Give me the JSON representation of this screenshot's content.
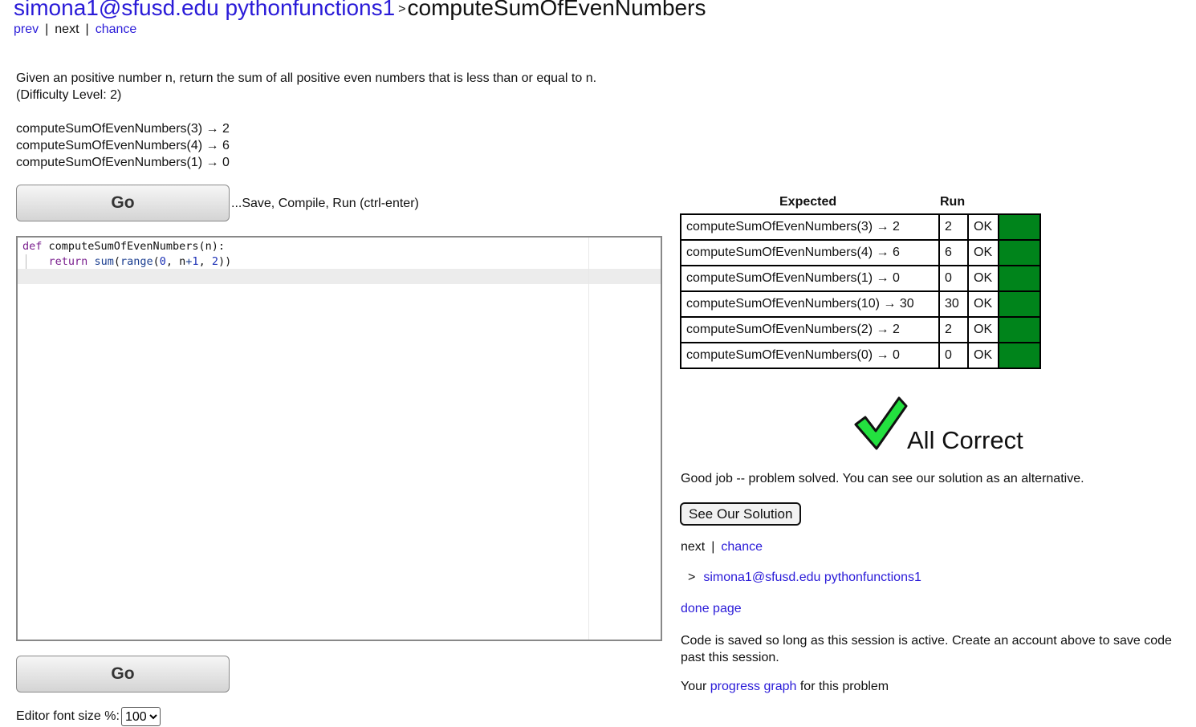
{
  "header": {
    "user_link": "simona1@sfusd.edu pythonfunctions1",
    "separator": ">",
    "problem_title": "computeSumOfEvenNumbers"
  },
  "top_nav": {
    "prev": "prev",
    "next": "next",
    "chance": "chance",
    "divider": "|"
  },
  "problem": {
    "description": "Given an positive number n, return the sum of all positive even numbers that is less than or equal to n.",
    "difficulty": "(Difficulty Level: 2)",
    "examples": [
      "computeSumOfEvenNumbers(3) → 2",
      "computeSumOfEvenNumbers(4) → 6",
      "computeSumOfEvenNumbers(1) → 0"
    ]
  },
  "go_button": {
    "label": "Go",
    "hint": "...Save, Compile, Run (ctrl-enter)"
  },
  "editor": {
    "line1": {
      "kw": "def",
      "rest": " computeSumOfEvenNumbers(n):"
    },
    "line2": {
      "indent": "    ",
      "kw": "return",
      "sp1": " ",
      "fn1": "sum",
      "p1": "(",
      "fn2": "range",
      "p2": "(",
      "n0": "0",
      "c1": ", n",
      "op": "+",
      "n1": "1",
      "c2": ", ",
      "n2": "2",
      "p3": "))"
    }
  },
  "font_size": {
    "label": "Editor font size %:",
    "selected": "100"
  },
  "results": {
    "header_expected": "Expected",
    "header_run": "Run",
    "pass_color": "#00841b",
    "rows": [
      {
        "expected": "computeSumOfEvenNumbers(3) → 2",
        "run": "2",
        "status": "OK"
      },
      {
        "expected": "computeSumOfEvenNumbers(4) → 6",
        "run": "6",
        "status": "OK"
      },
      {
        "expected": "computeSumOfEvenNumbers(1) → 0",
        "run": "0",
        "status": "OK"
      },
      {
        "expected": "computeSumOfEvenNumbers(10) → 30",
        "run": "30",
        "status": "OK"
      },
      {
        "expected": "computeSumOfEvenNumbers(2) → 2",
        "run": "2",
        "status": "OK"
      },
      {
        "expected": "computeSumOfEvenNumbers(0) → 0",
        "run": "0",
        "status": "OK"
      }
    ]
  },
  "verdict": {
    "icon": "checkmark-icon",
    "text": "All Correct",
    "message": "Good job -- problem solved. You can see our solution as an alternative."
  },
  "solution_button": "See Our Solution",
  "bottom_nav": {
    "next": "next",
    "chance": "chance",
    "divider": "|"
  },
  "breadcrumb": {
    "gt": ">",
    "link": "simona1@sfusd.edu pythonfunctions1"
  },
  "done_page": "done page",
  "saved_note": "Code is saved so long as this session is active. Create an account above to save code past this session.",
  "progress": {
    "prefix": "Your ",
    "link": "progress graph",
    "suffix": " for this problem"
  }
}
